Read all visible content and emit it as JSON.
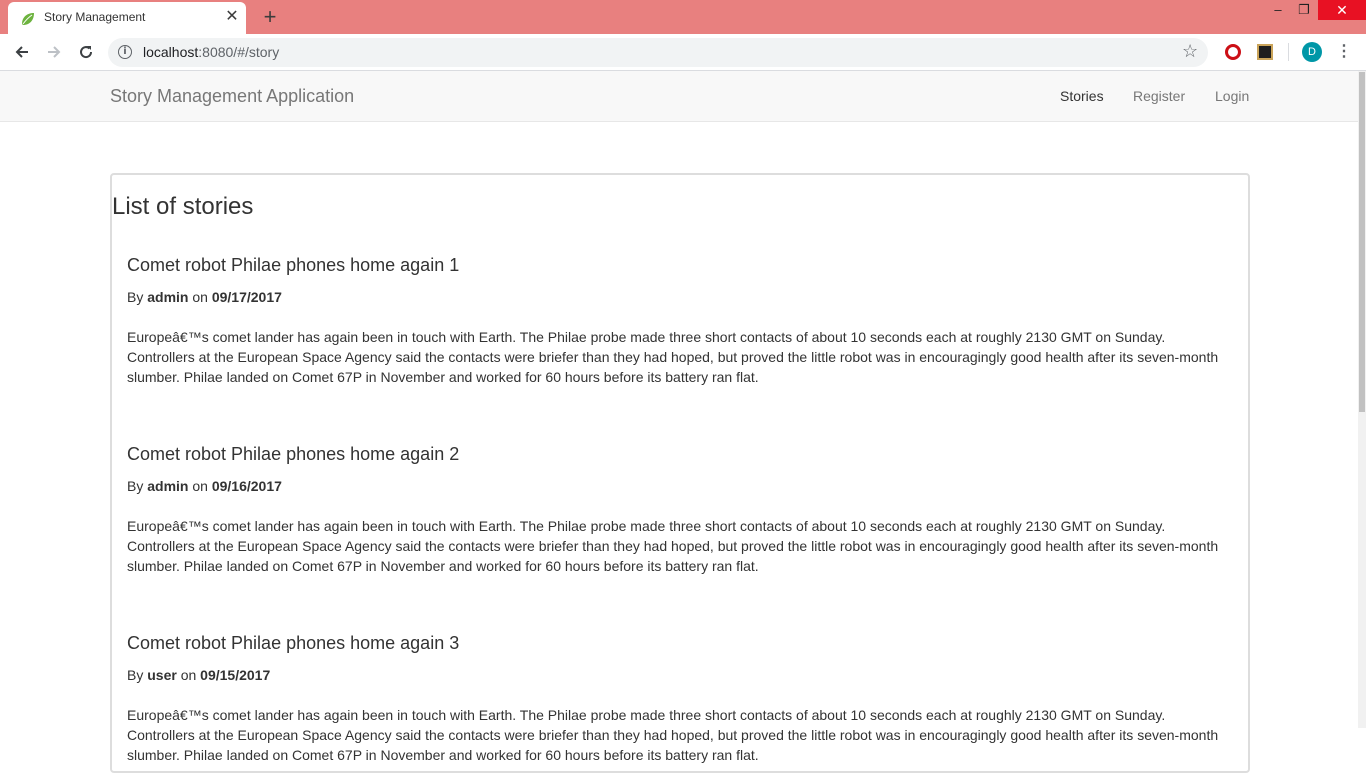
{
  "browser": {
    "tab_title": "Story Management",
    "tab_close": "✕",
    "new_tab": "+",
    "window_controls": {
      "minimize": "–",
      "restore": "❐",
      "close": "✕"
    },
    "url_host": "localhost",
    "url_path": ":8080/#/story",
    "profile_initial": "D",
    "favicon_color": "#6db33f",
    "tabstrip_color": "#e8807f"
  },
  "navbar": {
    "brand": "Story Management Application",
    "links": [
      {
        "label": "Stories",
        "active": true
      },
      {
        "label": "Register",
        "active": false
      },
      {
        "label": "Login",
        "active": false
      }
    ]
  },
  "panel": {
    "title": "List of stories",
    "stories": [
      {
        "title": "Comet robot Philae phones home again 1",
        "by_label": "By",
        "author": "admin",
        "on_label": "on",
        "date": "09/17/2017",
        "body": "Europeâ€™s comet lander has again been in touch with Earth. The Philae probe made three short contacts of about 10 seconds each at roughly 2130 GMT on Sunday. Controllers at the European Space Agency said the contacts were briefer than they had hoped, but proved the little robot was in encouragingly good health after its seven-month slumber. Philae landed on Comet 67P in November and worked for 60 hours before its battery ran flat."
      },
      {
        "title": "Comet robot Philae phones home again 2",
        "by_label": "By",
        "author": "admin",
        "on_label": "on",
        "date": "09/16/2017",
        "body": "Europeâ€™s comet lander has again been in touch with Earth. The Philae probe made three short contacts of about 10 seconds each at roughly 2130 GMT on Sunday. Controllers at the European Space Agency said the contacts were briefer than they had hoped, but proved the little robot was in encouragingly good health after its seven-month slumber. Philae landed on Comet 67P in November and worked for 60 hours before its battery ran flat."
      },
      {
        "title": "Comet robot Philae phones home again 3",
        "by_label": "By",
        "author": "user",
        "on_label": "on",
        "date": "09/15/2017",
        "body": "Europeâ€™s comet lander has again been in touch with Earth. The Philae probe made three short contacts of about 10 seconds each at roughly 2130 GMT on Sunday. Controllers at the European Space Agency said the contacts were briefer than they had hoped, but proved the little robot was in encouragingly good health after its seven-month slumber. Philae landed on Comet 67P in November and worked for 60 hours before its battery ran flat."
      }
    ]
  }
}
